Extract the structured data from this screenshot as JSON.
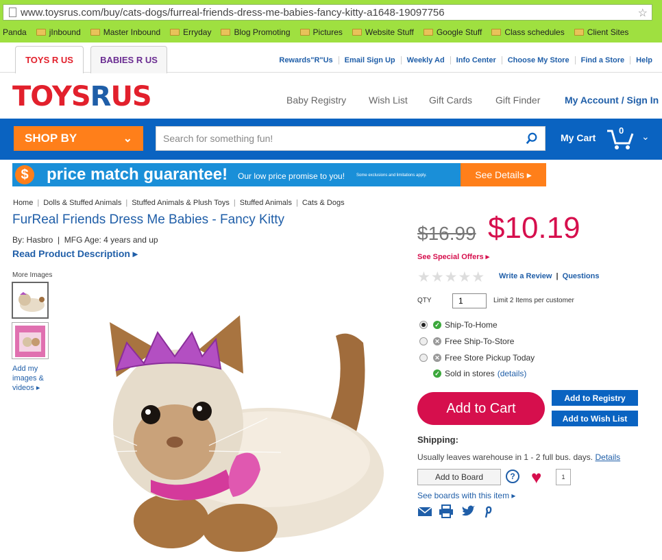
{
  "browser": {
    "url": "www.toysrus.com/buy/cats-dogs/furreal-friends-dress-me-babies-fancy-kitty-a1648-19097756",
    "bookmarks": [
      "Panda",
      "jInbound",
      "Master Inbound",
      "Erryday",
      "Blog Promoting",
      "Pictures",
      "Website Stuff",
      "Google Stuff",
      "Class schedules",
      "Client Sites"
    ]
  },
  "brand_tabs": {
    "tru": "TOYS R US",
    "bru": "BABIES R US"
  },
  "top_links": [
    "Rewards\"R\"Us",
    "Email Sign Up",
    "Weekly Ad",
    "Info Center",
    "Choose My Store",
    "Find a Store",
    "Help"
  ],
  "logo": {
    "part1": "TOYS",
    "part2": "R",
    "part3": "US"
  },
  "main_nav": {
    "baby_registry": "Baby Registry",
    "wish_list": "Wish List",
    "gift_cards": "Gift Cards",
    "gift_finder": "Gift Finder",
    "account": "My Account / Sign In"
  },
  "shop_by": "SHOP BY",
  "search": {
    "placeholder": "Search for something fun!"
  },
  "cart": {
    "label": "My Cart",
    "count": "0"
  },
  "promo": {
    "icon": "$",
    "headline": "price match guarantee!",
    "sub": "Our low price promise to you!",
    "fine": "Some exclusions and limitations apply.",
    "details": "See Details ▸"
  },
  "breadcrumbs": [
    "Home",
    "Dolls & Stuffed Animals",
    "Stuffed Animals & Plush Toys",
    "Stuffed Animals",
    "Cats & Dogs"
  ],
  "product": {
    "title": "FurReal Friends Dress Me Babies - Fancy Kitty",
    "byline": "By: Hasbro  |  MFG Age: 4 years and up",
    "read_desc": "Read Product Description ▸",
    "more_images": "More Images",
    "add_images": [
      "Add my",
      "images &",
      "videos ▸"
    ],
    "old_price": "$16.99",
    "new_price": "$10.19",
    "special_offers": "See Special Offers ▸",
    "stars": "★★★★★",
    "write_review": "Write a Review",
    "questions": "Questions",
    "qty_label": "QTY",
    "qty_value": "1",
    "limit": "Limit 2 Items per customer",
    "options": {
      "ship_home": "Ship-To-Home",
      "ship_store": "Free Ship-To-Store",
      "pickup": "Free Store Pickup Today",
      "sold": "Sold in stores",
      "sold_details": "(details)"
    },
    "add_to_cart": "Add to Cart",
    "add_registry": "Add to Registry",
    "add_wishlist": "Add to Wish List",
    "shipping_label": "Shipping:",
    "shipping_text": "Usually leaves warehouse in 1 - 2 full bus. days.",
    "shipping_details": "Details",
    "add_board": "Add to Board",
    "help": "?",
    "heart_count": "1",
    "see_boards": "See boards with this item ▸"
  },
  "colors": {
    "brand_blue": "#0a63c1",
    "accent_orange": "#ff7f1a",
    "price_red": "#d60f4d",
    "chrome_green": "#9fe040"
  }
}
